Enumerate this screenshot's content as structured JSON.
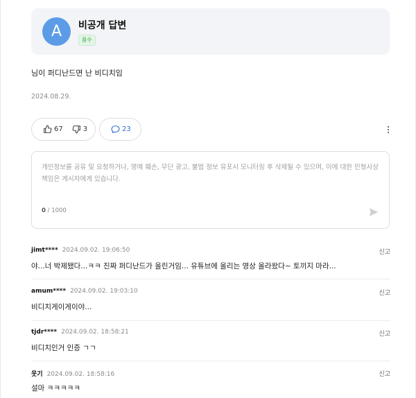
{
  "author": {
    "avatar_letter": "A",
    "name": "비공개 답변",
    "badge": "용수",
    "avatar_color": "#5c9ce6"
  },
  "answer": {
    "body": "님이 퍼디난드면 난 비디치임",
    "date": "2024.08.29."
  },
  "reactions": {
    "likes": "67",
    "dislikes": "3",
    "comments": "23",
    "like_icon": "thumbs-up-icon",
    "dislike_icon": "thumbs-down-icon",
    "comment_icon": "speech-bubble-icon",
    "more_icon": "vertical-ellipsis-icon",
    "accent_color": "#2f6fd0"
  },
  "editor": {
    "placeholder": "개인정보를 공유 및 요청하거나, 명예 훼손, 무단 광고, 불법 정보 유포시 모니터링 후 삭제될 수 있으며, 이에 대한 민형사상 책임은 게시자에게 있습니다.",
    "counter_current": "0",
    "counter_max": " / 1000",
    "send_icon": "send-arrow-icon"
  },
  "comments": [
    {
      "user": "jimt****",
      "date": "2024.09.02. 19:06:50",
      "text": "야...너 박제됐다...ㅋㅋ 진짜 퍼디난드가 올린거임... 유튜브에 올리는 영상 올라왔다~ 토끼지 마라...",
      "report": "신고"
    },
    {
      "user": "amum****",
      "date": "2024.09.02. 19:03:10",
      "text": "비디치게이게이야...",
      "report": "신고"
    },
    {
      "user": "tjdr****",
      "date": "2024.09.02. 18:58:21",
      "text": "비디치인거 인증 ㄱㄱ",
      "report": "신고"
    },
    {
      "user": "웃기",
      "date": "2024.09.02. 18:58:16",
      "text": "설마 ㅋㅋㅋㅋㅋ",
      "report": "신고"
    }
  ]
}
